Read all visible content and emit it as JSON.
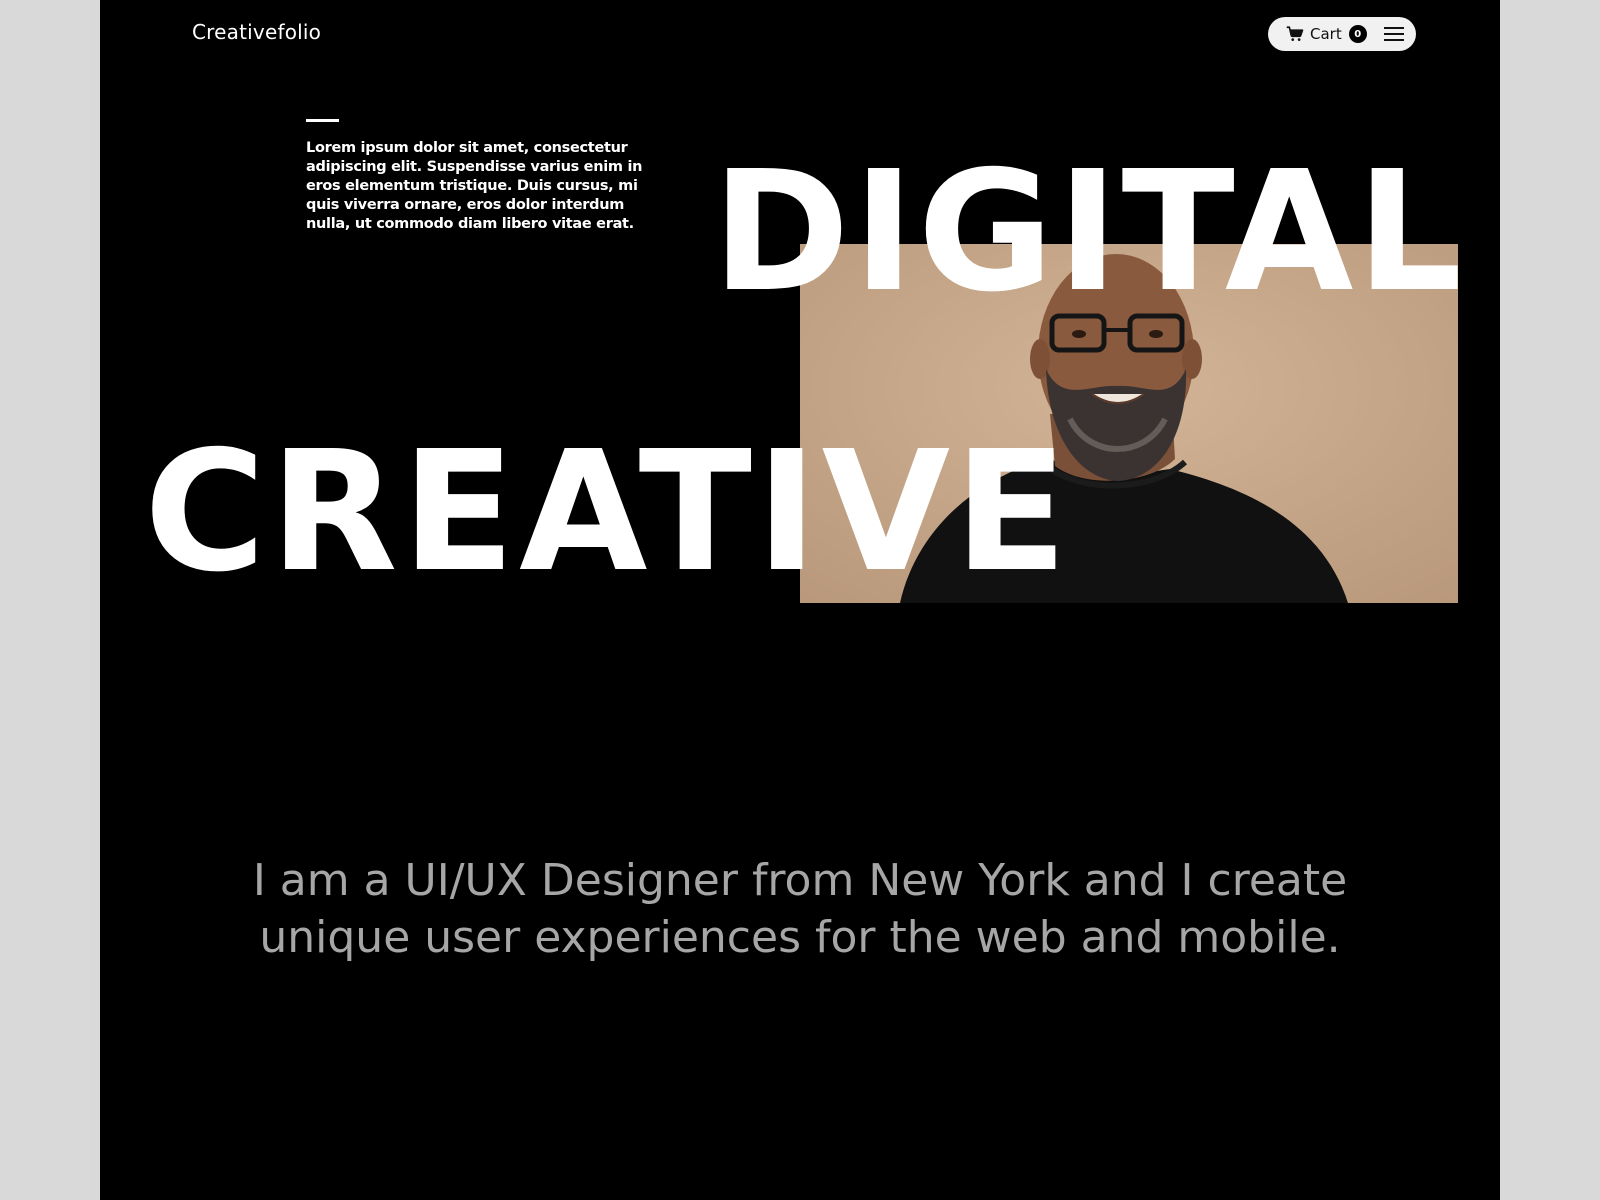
{
  "header": {
    "logo": "Creativefolio",
    "cart_label": "Cart",
    "cart_count": "0",
    "icons": {
      "cart": "cart-icon",
      "menu": "hamburger-menu-icon"
    }
  },
  "hero": {
    "intro": "Lorem ipsum dolor sit amet, consectetur adipiscing elit. Suspendisse varius enim in eros elementum tristique. Duis cursus, mi quis viverra ornare, eros dolor interdum nulla, ut commodo diam libero vitae erat.",
    "word_top": "DIGITAL",
    "word_bottom": "CREATIVE",
    "photo_bg_color": "#c8a888"
  },
  "about": {
    "line1": "I am a UI/UX Designer from New York and I create",
    "line2": "unique user experiences for the web and mobile."
  },
  "colors": {
    "page_bg": "#000000",
    "outer_bg": "#d9d9d9",
    "text_primary": "#ffffff",
    "text_muted": "#a6a6a6"
  }
}
